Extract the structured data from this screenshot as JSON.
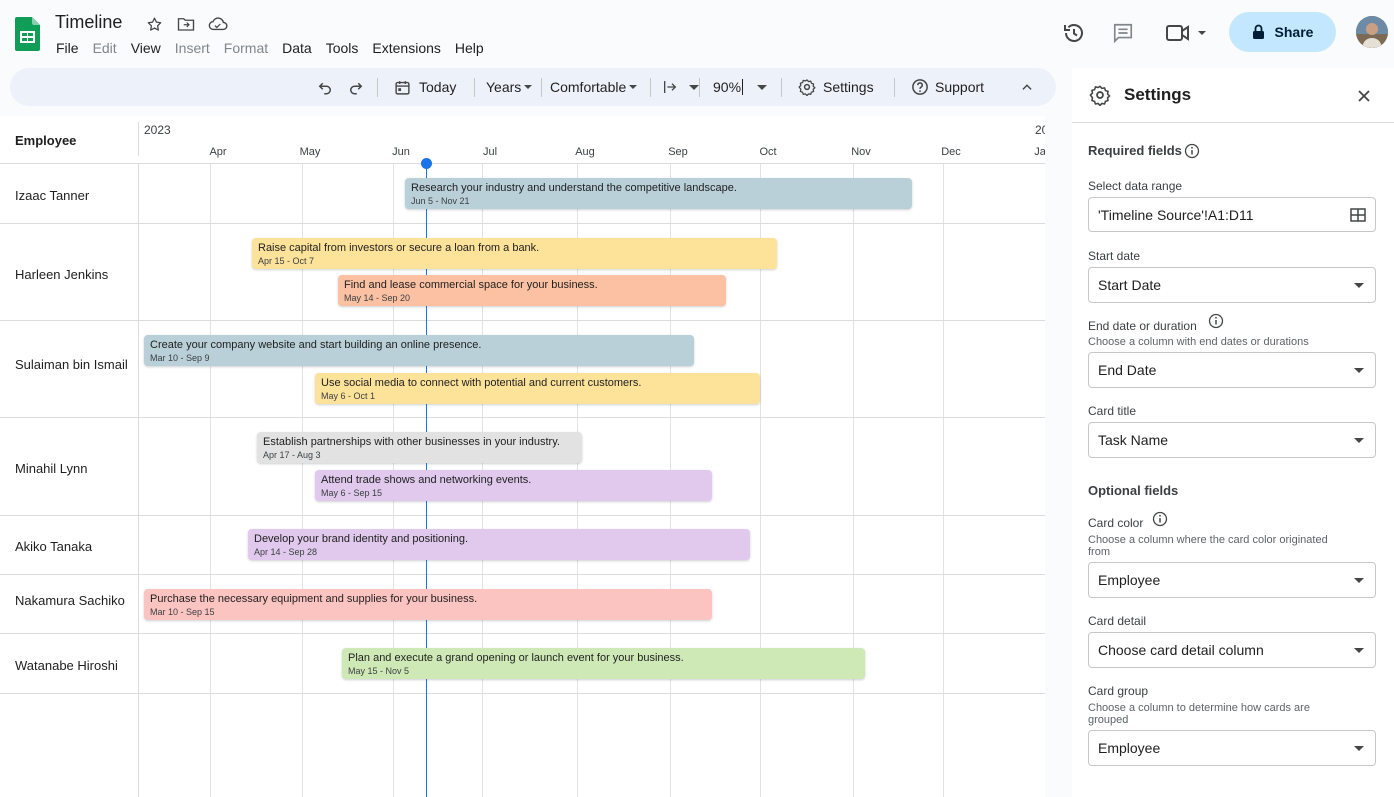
{
  "app": {
    "title": "Timeline",
    "menu": [
      {
        "label": "File",
        "disabled": false
      },
      {
        "label": "Edit",
        "disabled": true
      },
      {
        "label": "View",
        "disabled": false
      },
      {
        "label": "Insert",
        "disabled": true
      },
      {
        "label": "Format",
        "disabled": true
      },
      {
        "label": "Data",
        "disabled": false
      },
      {
        "label": "Tools",
        "disabled": false
      },
      {
        "label": "Extensions",
        "disabled": false
      },
      {
        "label": "Help",
        "disabled": false
      }
    ],
    "share_label": "Share"
  },
  "toolbar": {
    "today_label": "Today",
    "scale_label": "Years",
    "density_label": "Comfortable",
    "zoom_label": "90%",
    "settings_label": "Settings",
    "support_label": "Support"
  },
  "timeline": {
    "employee_header": "Employee",
    "years": [
      "2023",
      "20"
    ],
    "months": [
      "Apr",
      "May",
      "Jun",
      "Jul",
      "Aug",
      "Sep",
      "Oct",
      "Nov",
      "Dec",
      "Ja"
    ],
    "rows": [
      {
        "name": "Izaac Tanner",
        "cards": [
          {
            "title": "Research your industry and understand the competitive landscape.",
            "dates": "Jun 5 - Nov 21",
            "color": "#b9d0d8"
          }
        ]
      },
      {
        "name": "Harleen Jenkins",
        "cards": [
          {
            "title": "Raise capital from investors or secure a loan from a bank.",
            "dates": "Apr 15 - Oct 7",
            "color": "#fde29a"
          },
          {
            "title": "Find and lease commercial space for your business.",
            "dates": "May 14 - Sep 20",
            "color": "#fcc0a2"
          }
        ]
      },
      {
        "name": "Sulaiman bin Ismail",
        "cards": [
          {
            "title": "Create your company website and start building an online presence.",
            "dates": "Mar 10 - Sep 9",
            "color": "#b9d0d8"
          },
          {
            "title": "Use social media to connect with potential and current customers.",
            "dates": "May 6 - Oct 1",
            "color": "#fde29a"
          }
        ]
      },
      {
        "name": "Minahil Lynn",
        "cards": [
          {
            "title": "Establish partnerships with other businesses in your industry.",
            "dates": "Apr 17 - Aug 3",
            "color": "#e2e2e2"
          },
          {
            "title": "Attend trade shows and networking events.",
            "dates": "May 6 - Sep 15",
            "color": "#e0c9ec"
          }
        ]
      },
      {
        "name": "Akiko Tanaka",
        "cards": [
          {
            "title": "Develop your brand identity and positioning.",
            "dates": "Apr 14 - Sep 28",
            "color": "#e0c9ec"
          }
        ]
      },
      {
        "name": "Nakamura Sachiko",
        "cards": [
          {
            "title": "Purchase the necessary equipment and supplies for your business.",
            "dates": "Mar 10 - Sep 15",
            "color": "#fcc4c0"
          }
        ]
      },
      {
        "name": "Watanabe Hiroshi",
        "cards": [
          {
            "title": "Plan and execute a grand opening or launch event for your business.",
            "dates": "May 15 - Nov 5",
            "color": "#cfe9b6"
          }
        ]
      }
    ]
  },
  "settings": {
    "title": "Settings",
    "required_title": "Required fields",
    "data_range_label": "Select data range",
    "data_range_value": "'Timeline Source'!A1:D11",
    "start_date_label": "Start date",
    "start_date_value": "Start Date",
    "end_date_label": "End date or duration",
    "end_date_desc": "Choose a column with end dates or durations",
    "end_date_value": "End Date",
    "card_title_label": "Card title",
    "card_title_value": "Task Name",
    "optional_title": "Optional fields",
    "card_color_label": "Card color",
    "card_color_desc": "Choose a column where the card color originated from",
    "card_color_value": "Employee",
    "card_detail_label": "Card detail",
    "card_detail_value": "Choose card detail column",
    "card_group_label": "Card group",
    "card_group_desc": "Choose a column to determine how cards are grouped",
    "card_group_value": "Employee"
  }
}
